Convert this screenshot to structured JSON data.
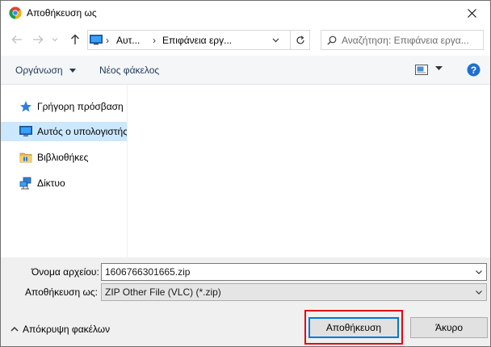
{
  "window": {
    "title": "Αποθήκευση ως"
  },
  "address": {
    "crumbs": [
      "Αυτ...",
      "Επιφάνεια εργ..."
    ],
    "search_placeholder": "Αναζήτηση: Επιφάνεια εργα..."
  },
  "toolbar": {
    "organize_label": "Οργάνωση",
    "new_folder_label": "Νέος φάκελος"
  },
  "nav_pane": {
    "items": [
      {
        "label": "Γρήγορη πρόσβαση",
        "icon": "star-icon",
        "selected": false
      },
      {
        "label": "Αυτός ο υπολογιστής",
        "icon": "computer-icon",
        "selected": true
      },
      {
        "label": "Βιβλιοθήκες",
        "icon": "library-icon",
        "selected": false
      },
      {
        "label": "Δίκτυο",
        "icon": "network-icon",
        "selected": false
      }
    ]
  },
  "form": {
    "filename_label": "Όνομα αρχείου:",
    "filename_value": "1606766301665.zip",
    "savetype_label": "Αποθήκευση ως:",
    "savetype_value": "ZIP Other File (VLC) (*.zip)"
  },
  "footer": {
    "hide_folders_label": "Απόκρυψη φακέλων",
    "save_label": "Αποθήκευση",
    "cancel_label": "Άκυρο"
  },
  "colors": {
    "selection": "#cce8ff",
    "accent": "#0078d7",
    "highlight_outline": "#e30613"
  }
}
